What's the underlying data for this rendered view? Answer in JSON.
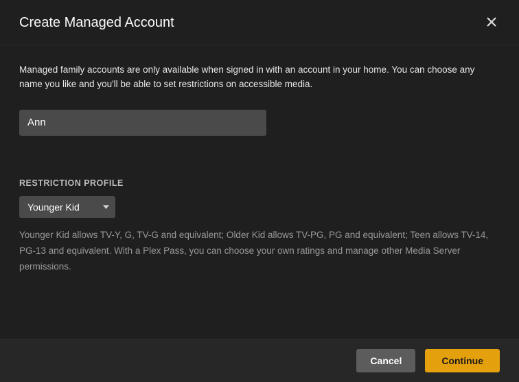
{
  "header": {
    "title": "Create Managed Account"
  },
  "body": {
    "description": "Managed family accounts are only available when signed in with an account in your home. You can choose any name you like and you'll be able to set restrictions on accessible media.",
    "name_value": "Ann",
    "name_placeholder": ""
  },
  "restriction": {
    "label": "RESTRICTION PROFILE",
    "selected": "Younger Kid",
    "description": "Younger Kid allows TV-Y, G, TV-G and equivalent; Older Kid allows TV-PG, PG and equivalent; Teen allows TV-14, PG-13 and equivalent. With a Plex Pass, you can choose your own ratings and manage other Media Server permissions."
  },
  "footer": {
    "cancel": "Cancel",
    "continue": "Continue"
  }
}
